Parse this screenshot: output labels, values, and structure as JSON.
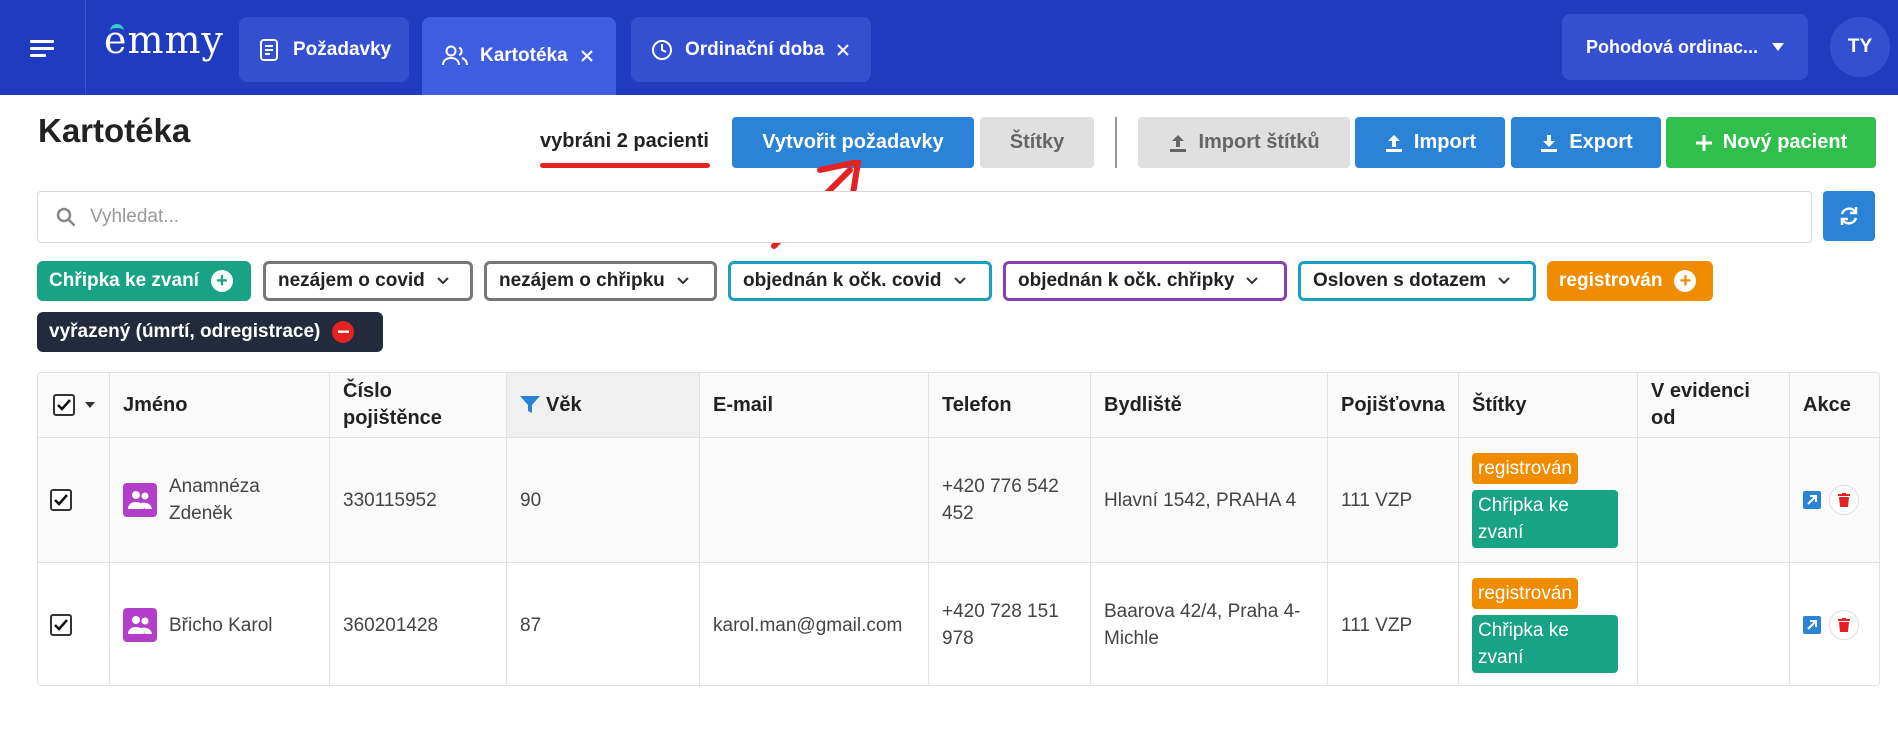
{
  "header": {
    "logo": "emmy",
    "tabs": [
      {
        "label": "Požadavky",
        "icon": "document-icon",
        "closable": false,
        "active": false
      },
      {
        "label": "Kartotéka",
        "icon": "users-icon",
        "closable": true,
        "active": true
      },
      {
        "label": "Ordinační doba",
        "icon": "clock-icon",
        "closable": true,
        "active": false
      }
    ],
    "clinic": "Pohodová ordinac...",
    "avatar_initials": "TY"
  },
  "page": {
    "title": "Kartotéka",
    "selected_text": "vybráni 2 pacienti"
  },
  "toolbar": {
    "create_requests": "Vytvořit požadavky",
    "tags": "Štítky",
    "import_tags": "Import štítků",
    "import": "Import",
    "export": "Export",
    "new_patient": "Nový pacient"
  },
  "search": {
    "placeholder": "Vyhledat...",
    "value": ""
  },
  "filters": [
    {
      "label": "Chřipka ke zvaní",
      "style": "solid",
      "color": "#18a384",
      "icon": "plus-icon"
    },
    {
      "label": "nezájem o covid",
      "style": "outline",
      "color": "#777777",
      "icon": "chevron-down-icon"
    },
    {
      "label": "nezájem o chřipku",
      "style": "outline",
      "color": "#777777",
      "icon": "chevron-down-icon"
    },
    {
      "label": "objednán k očk. covid",
      "style": "outline",
      "color": "#1aa0c0",
      "icon": "chevron-down-icon"
    },
    {
      "label": "objednán k očk. chřipky",
      "style": "outline",
      "color": "#8a3fb0",
      "icon": "chevron-down-icon"
    },
    {
      "label": "Osloven s dotazem",
      "style": "outline",
      "color": "#1aa0c0",
      "icon": "chevron-down-icon"
    },
    {
      "label": "registrován",
      "style": "solid",
      "color": "#ef8c00",
      "icon": "plus-icon"
    },
    {
      "label": "vyřazený (úmrtí, odregistrace)",
      "style": "solid",
      "color": "#232a3d",
      "icon": "minus-icon"
    }
  ],
  "table": {
    "columns": [
      "Jméno",
      "Číslo pojištěnce",
      "Věk",
      "E-mail",
      "Telefon",
      "Bydliště",
      "Pojišťovna",
      "Štítky",
      "V evidenci od",
      "Akce"
    ],
    "rows": [
      {
        "checked": true,
        "name": "Anamnéza Zdeněk",
        "insurance_no": "330115952",
        "age": "90",
        "email": "",
        "phone": "+420 776 542 452",
        "address": "Hlavní 1542, PRAHA 4",
        "insurer": "111 VZP",
        "tags": [
          "registrován",
          "Chřipka ke zvaní"
        ],
        "since": ""
      },
      {
        "checked": true,
        "name": "Břicho Karol",
        "insurance_no": "360201428",
        "age": "87",
        "email": "karol.man@gmail.com",
        "phone": "+420 728 151 978",
        "address": "Baarova 42/4, Praha 4-Michle",
        "insurer": "111 VZP",
        "tags": [
          "registrován",
          "Chřipka ke zvaní"
        ],
        "since": ""
      }
    ]
  },
  "colors": {
    "topbar": "#1f3bbf",
    "primary": "#2a83d6",
    "success": "#2fbf4a",
    "annotation": "#e52222"
  }
}
